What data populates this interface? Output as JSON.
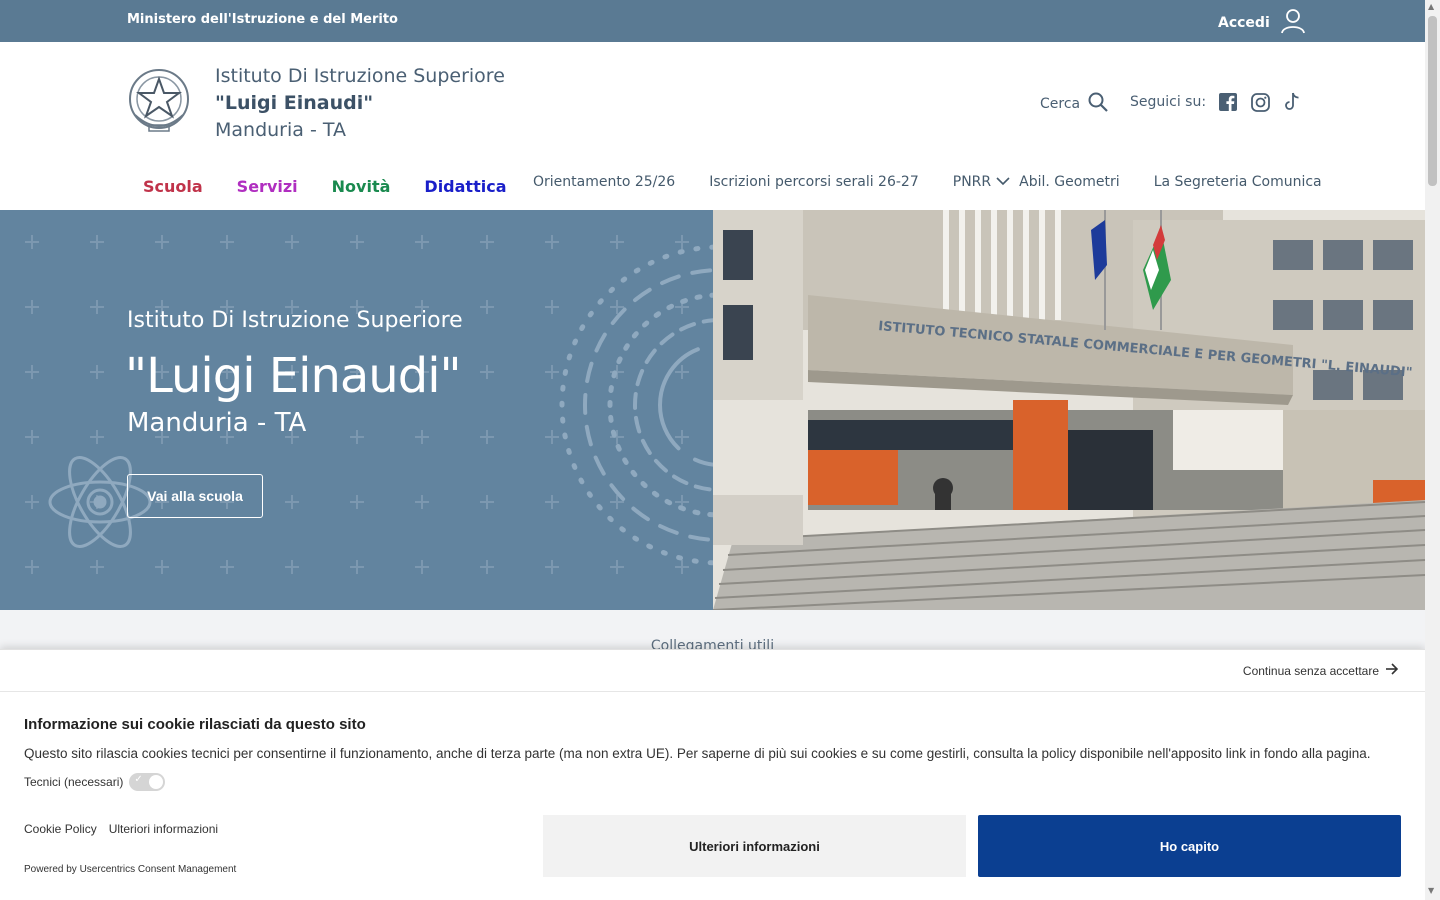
{
  "topbar": {
    "ministry": "Ministero dell'Istruzione e del Merito",
    "login_label": "Accedi",
    "bg_color": "#5a7a93"
  },
  "header": {
    "logo_icon": "italian-republic-emblem-icon",
    "brand_line1": "Istituto Di Istruzione Superiore",
    "brand_name": "\"Luigi Einaudi\"",
    "brand_city": "Manduria - TA",
    "search_label": "Cerca",
    "social_label": "Seguici su:",
    "social_icons": [
      "facebook-icon",
      "instagram-icon",
      "tiktok-icon"
    ]
  },
  "nav_main": [
    {
      "label": "Scuola",
      "color": "#c0334a"
    },
    {
      "label": "Servizi",
      "color": "#b02ec0"
    },
    {
      "label": "Novità",
      "color": "#1a8a4f"
    },
    {
      "label": "Didattica",
      "color": "#1a1fc9"
    }
  ],
  "nav_secondary": [
    {
      "label": "Orientamento 25/26"
    },
    {
      "label": "Iscrizioni percorsi serali 26-27"
    },
    {
      "label": "PNRR"
    },
    {
      "label": "Abil. Geometri"
    },
    {
      "label": "La Segreteria Comunica"
    }
  ],
  "hero": {
    "subtitle": "Istituto Di Istruzione Superiore",
    "title": "\"Luigi Einaudi\"",
    "city": "Manduria - TA",
    "button_label": "Vai alla scuola",
    "bg_color": "#62849f",
    "image_signage": "ISTITUTO TECNICO STATALE COMMERCIALE E PER GEOMETRI \"L. EINAUDI\" MANDURIA"
  },
  "links_strip": {
    "label": "Collegamenti utili"
  },
  "cookie_banner": {
    "continue_label": "Continua senza accettare",
    "title": "Informazione sui cookie rilasciati da questo sito",
    "description": "Questo sito rilascia cookies tecnici per consentirne il funzionamento, anche di terza parte (ma non extra UE). Per saperne di più sui cookies e su come gestirli, consulta la policy disponibile nell'apposito link in fondo alla pagina.",
    "toggle_label": "Tecnici (necessari)",
    "toggle_on": true,
    "link_policy": "Cookie Policy",
    "link_more": "Ulteriori informazioni",
    "powered_by": "Powered by Usercentrics Consent Management",
    "btn_more": "Ulteriori informazioni",
    "btn_ok": "Ho capito",
    "btn_ok_color": "#0b3f91"
  }
}
